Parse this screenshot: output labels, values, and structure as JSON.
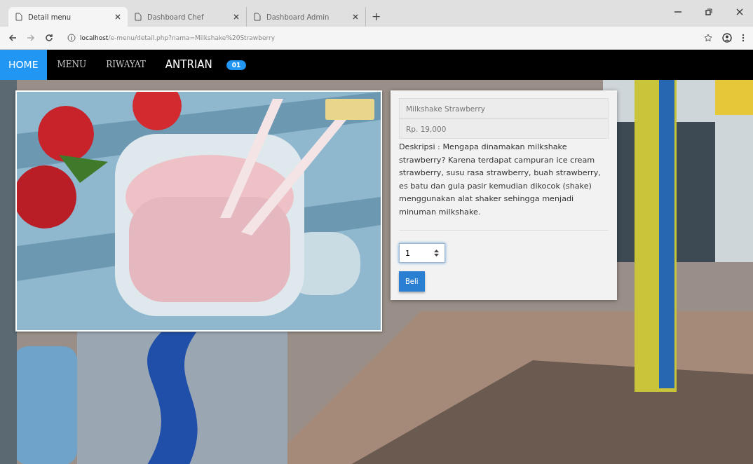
{
  "browser": {
    "tabs": [
      {
        "title": "Detail menu",
        "selected": true
      },
      {
        "title": "Dashboard Chef",
        "selected": false
      },
      {
        "title": "Dashboard Admin",
        "selected": false
      }
    ],
    "new_tab": "+",
    "url_host": "localhost",
    "url_path": "/e-menu/detail.php?nama=Milkshake%20Strawberry"
  },
  "navbar": {
    "items": [
      {
        "label": "HOME",
        "selected": true
      },
      {
        "label": "MENU",
        "selected": false
      },
      {
        "label": "RIWAYAT",
        "selected": false
      },
      {
        "label": "ANTRIAN",
        "selected": false
      }
    ],
    "badge": "01"
  },
  "product": {
    "name": "Milkshake Strawberry",
    "price": "Rp. 19,000",
    "description": "Deskripsi : Mengapa dinamakan milkshake strawberry? Karena terdapat campuran ice cream strawberry, susu rasa strawberry, buah strawberry, es batu dan gula pasir kemudian dikocok (shake) menggunakan alat shaker sehingga menjadi minuman milkshake.",
    "quantity": "1",
    "buy_button": "Beli"
  }
}
